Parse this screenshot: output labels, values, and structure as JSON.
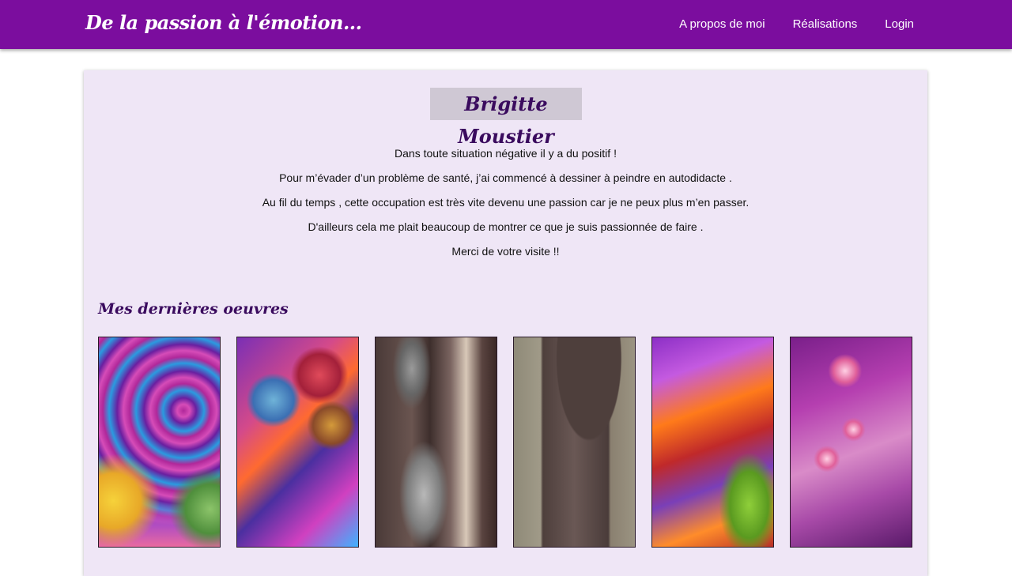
{
  "navbar": {
    "brand": "De la passion à l'émotion...",
    "links": [
      "A propos de moi",
      "Réalisations",
      "Login"
    ]
  },
  "profile": {
    "name": "Brigitte Moustier",
    "intro": [
      "Dans toute situation négative il y a du positif !",
      "Pour m’évader d’un  problème de santé, j’ai commencé à dessiner  à peindre en autodidacte .",
      "Au fil du temps , cette occupation est très vite devenu une passion car je ne peux plus m’en passer.",
      "D'ailleurs cela me plait beaucoup de montrer ce que je suis passionnée de faire .",
      "Merci de votre visite !!"
    ]
  },
  "gallery": {
    "title": "Mes dernières oeuvres",
    "artworks": [
      {
        "subject": "purple swirl with yellow and green trees"
      },
      {
        "subject": "abstract colorful flowers"
      },
      {
        "subject": "chain and padlock on wood"
      },
      {
        "subject": "old wooden door in stone wall"
      },
      {
        "subject": "abstract purple orange green"
      },
      {
        "subject": "pink flowers on purple"
      }
    ]
  },
  "colors": {
    "navbar": "#7b0d9e",
    "card_background": "#efe6f6",
    "title_text": "#3a0b5e"
  }
}
